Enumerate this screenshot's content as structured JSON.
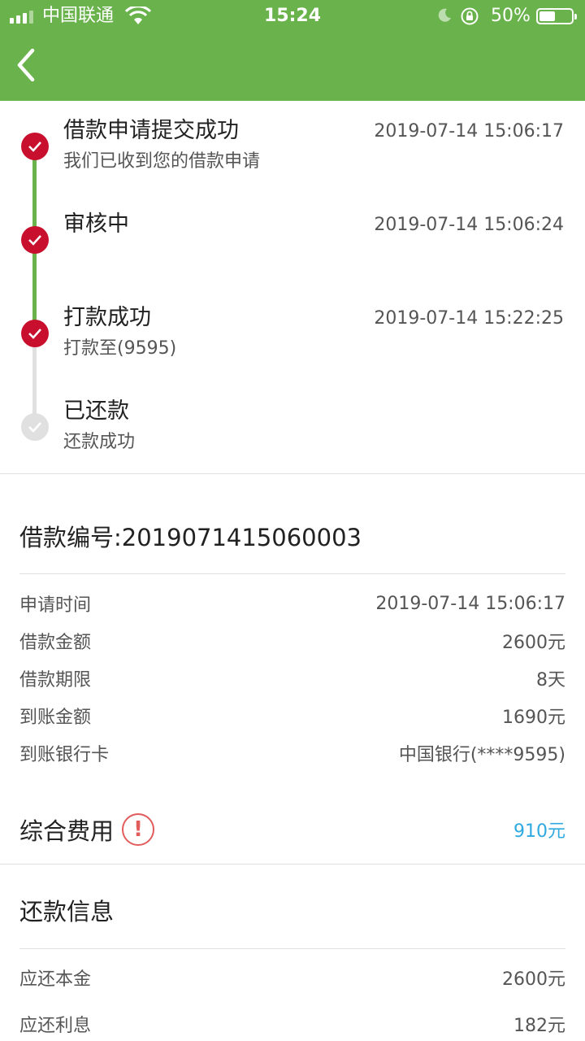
{
  "status_bar": {
    "carrier": "中国联通",
    "time": "15:24",
    "battery_pct": "50%",
    "battery_level": 0.5,
    "icons": [
      "signal-icon",
      "wifi-icon",
      "moon-icon",
      "rotation-lock-icon",
      "battery-icon"
    ]
  },
  "header": {
    "back_icon": "chevron-left-icon"
  },
  "timeline": [
    {
      "title": "借款申请提交成功",
      "subtitle": "我们已收到您的借款申请",
      "time": "2019-07-14 15:06:17",
      "state": "done"
    },
    {
      "title": "审核中",
      "subtitle": "",
      "time": "2019-07-14 15:06:24",
      "state": "done"
    },
    {
      "title": "打款成功",
      "subtitle": "打款至(9595)",
      "time": "2019-07-14 15:22:25",
      "state": "done"
    },
    {
      "title": "已还款",
      "subtitle": "还款成功",
      "time": "",
      "state": "pending"
    }
  ],
  "loan": {
    "title": "借款编号:2019071415060003",
    "rows": [
      {
        "label": "申请时间",
        "value": "2019-07-14 15:06:17"
      },
      {
        "label": "借款金额",
        "value": "2600元"
      },
      {
        "label": "借款期限",
        "value": "8天"
      },
      {
        "label": "到账金额",
        "value": "1690元"
      },
      {
        "label": "到账银行卡",
        "value": "中国银行(****9595)"
      }
    ]
  },
  "fee": {
    "label": "综合费用",
    "icon_glyph": "!",
    "value": "910元"
  },
  "repayment": {
    "title": "还款信息",
    "rows": [
      {
        "label": "应还本金",
        "value": "2600元"
      },
      {
        "label": "应还利息",
        "value": "182元"
      }
    ]
  },
  "colors": {
    "header_green": "#6ab34c",
    "done_red": "#c8102e",
    "timeline_green": "#6ab34c",
    "pending_gray": "#e0e0e0",
    "fee_blue": "#2fa9e0",
    "warn_red": "#e25c5c"
  }
}
